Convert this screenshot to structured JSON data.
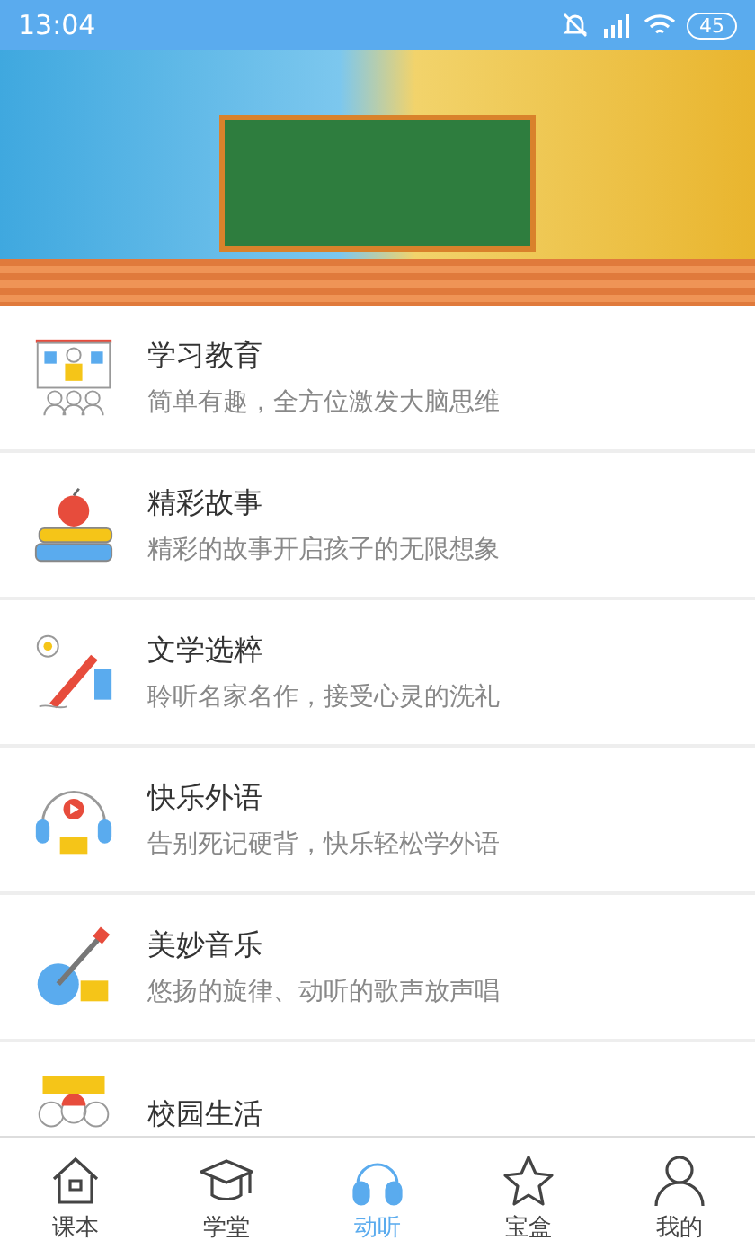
{
  "status_bar": {
    "time": "13:04",
    "battery": "45"
  },
  "list": [
    {
      "title": "学习教育",
      "subtitle": "简单有趣，全方位激发大脑思维"
    },
    {
      "title": "精彩故事",
      "subtitle": "精彩的故事开启孩子的无限想象"
    },
    {
      "title": "文学选粹",
      "subtitle": "聆听名家名作，接受心灵的洗礼"
    },
    {
      "title": "快乐外语",
      "subtitle": "告别死记硬背，快乐轻松学外语"
    },
    {
      "title": "美妙音乐",
      "subtitle": "悠扬的旋律、动听的歌声放声唱"
    },
    {
      "title": "校园生活"
    }
  ],
  "tabs": [
    {
      "label": "课本",
      "selected": false
    },
    {
      "label": "学堂",
      "selected": false
    },
    {
      "label": "动听",
      "selected": true
    },
    {
      "label": "宝盒",
      "selected": false
    },
    {
      "label": "我的",
      "selected": false
    }
  ]
}
